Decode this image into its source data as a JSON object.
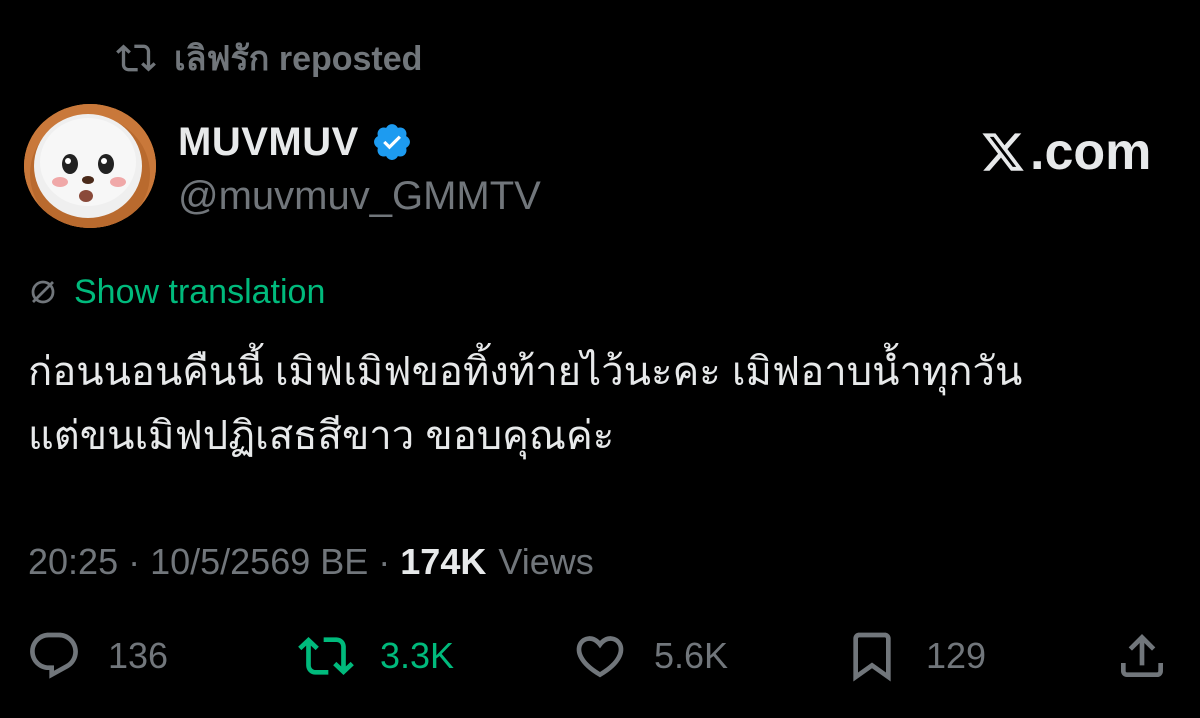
{
  "repost_banner": {
    "name": "เลิฟรัก",
    "label": "reposted"
  },
  "author": {
    "display_name": "MUVMUV",
    "handle": "@muvmuv_GMMTV",
    "verified": true
  },
  "watermark": {
    "text": ".com"
  },
  "translation": {
    "label": "Show translation"
  },
  "tweet": {
    "lines": [
      "ก่อนนอนคืนนี้ เมิฟเมิฟขอทิ้งท้ายไว้นะคะ เมิฟอาบน้ำทุกวัน",
      "แต่ขนเมิฟปฏิเสธสีขาว ขอบคุณค่ะ"
    ]
  },
  "meta": {
    "time": "20:25",
    "date": "10/5/2569 BE",
    "views_count": "174K",
    "views_label": "Views",
    "separator": "·"
  },
  "actions": {
    "reply_count": "136",
    "repost_count": "3.3K",
    "like_count": "5.6K",
    "bookmark_count": "129"
  },
  "colors": {
    "background": "#000000",
    "text": "#e7e9ea",
    "muted": "#71767b",
    "accent_green": "#00ba7c",
    "verified_blue": "#1d9bf0"
  },
  "icons": [
    "repost-icon",
    "verified-badge-icon",
    "x-logo-icon",
    "translate-icon",
    "reply-icon",
    "like-icon",
    "bookmark-icon",
    "share-icon"
  ]
}
